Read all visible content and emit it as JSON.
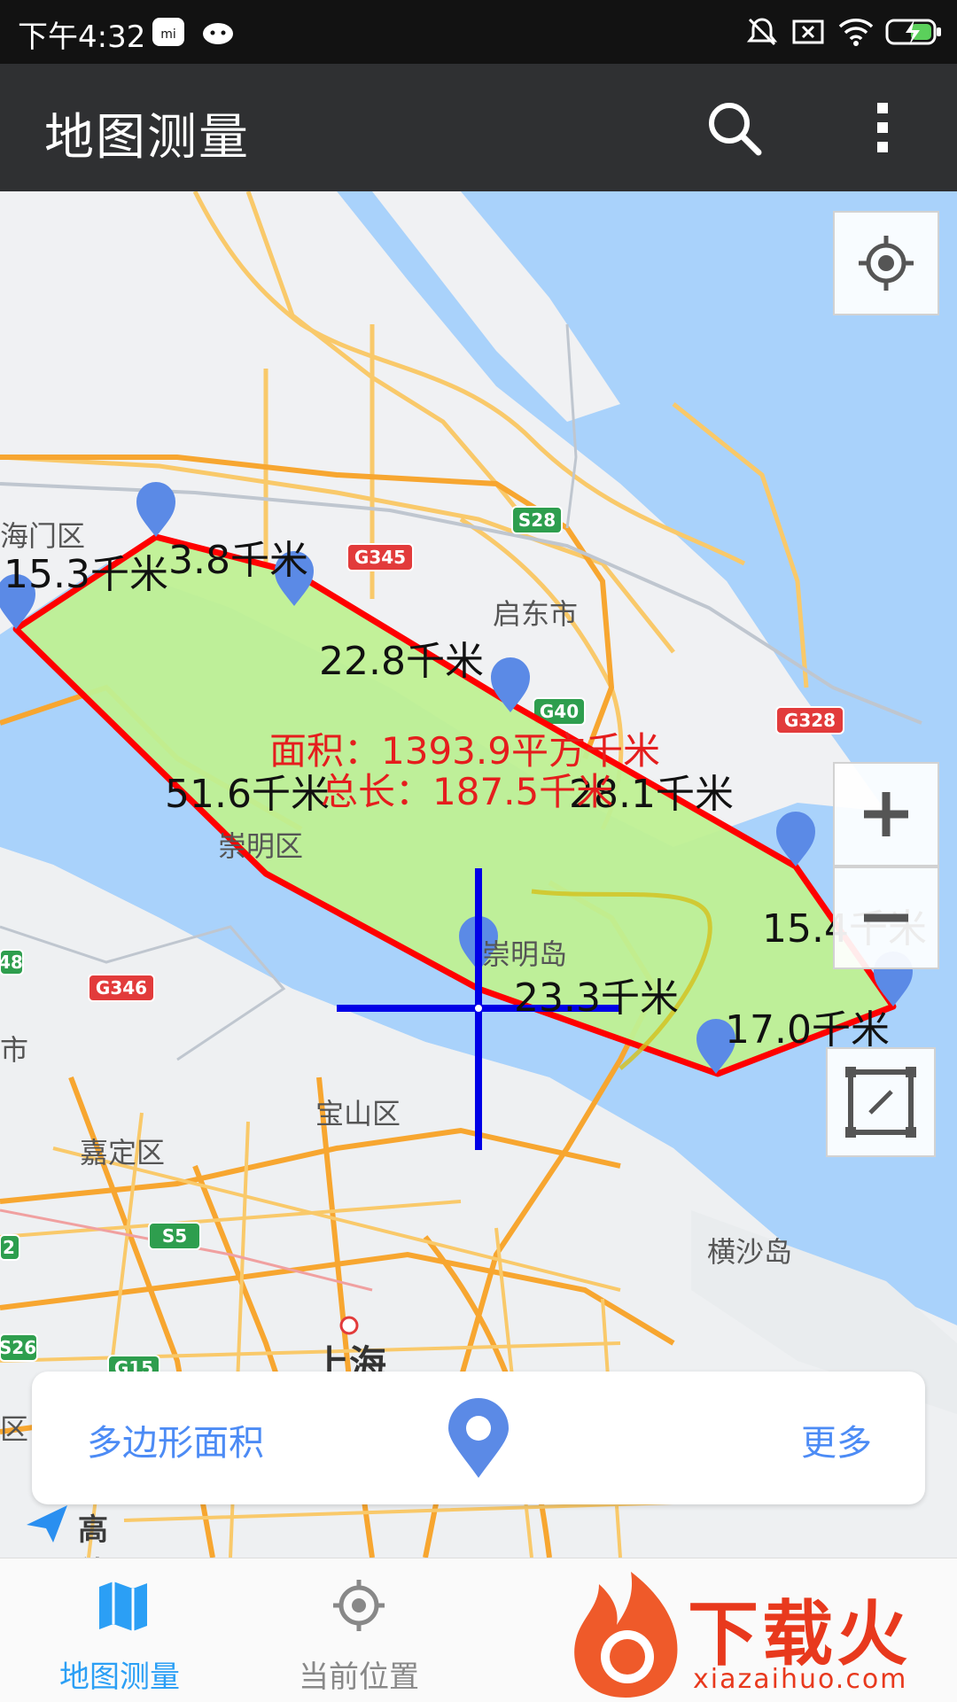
{
  "status_bar": {
    "time": "下午4:32"
  },
  "app_bar": {
    "title": "地图测量"
  },
  "map": {
    "place_labels": [
      "海门区",
      "启东市",
      "崇明区",
      "崇明岛",
      "嘉定区",
      "宝山区",
      "横沙岛",
      "上海",
      "市",
      "区"
    ],
    "road_shields": [
      "S28",
      "G345",
      "G40",
      "G328",
      "G346",
      "S5",
      "S26",
      "G15",
      "48",
      "2"
    ],
    "segment_distances": [
      "15.3千米",
      "3.8千米",
      "22.8千米",
      "28.1千米",
      "15.4千米",
      "17.0千米",
      "23.3千米",
      "51.6千米"
    ],
    "area_text": "面积：1393.9平方千米",
    "total_length_text": "总长：187.5千米",
    "polygon_color": "#ff0000",
    "fill_color": "#b8f08e",
    "crosshair_color": "#0000e6",
    "attribution": "高德地图"
  },
  "panel": {
    "left_label": "多边形面积",
    "right_label": "更多"
  },
  "bottom_nav": {
    "items": [
      {
        "label": "地图测量",
        "icon": "map-icon",
        "active": true
      },
      {
        "label": "当前位置",
        "icon": "location-target-icon",
        "active": false
      }
    ],
    "active_color": "#2b9ff5",
    "inactive_color": "#888888"
  },
  "watermark": {
    "brand": "下载火",
    "url": "xiazaihuo.com"
  }
}
